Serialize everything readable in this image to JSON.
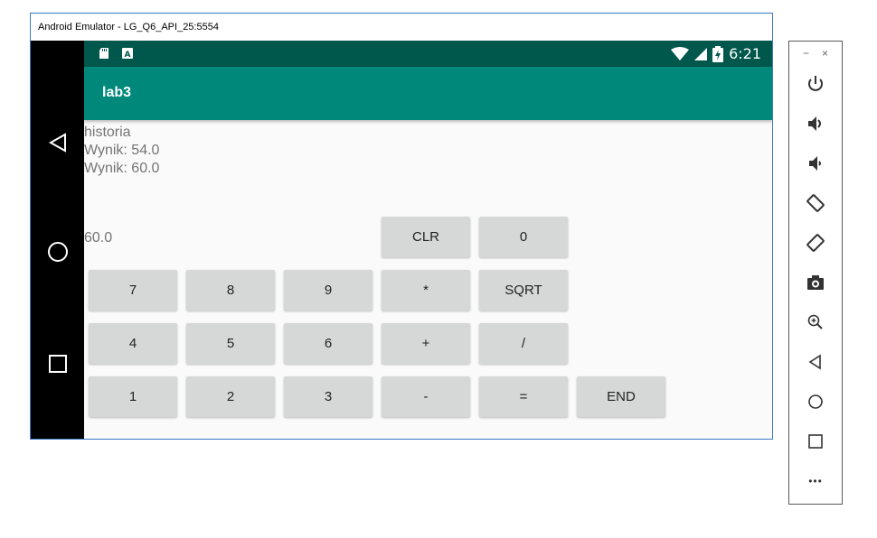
{
  "window": {
    "title": "Android Emulator - LG_Q6_API_25:5554"
  },
  "status_bar": {
    "time": "6:21",
    "icons": [
      "sd-card-icon",
      "keyboard-a-icon",
      "wifi-icon",
      "signal-icon",
      "battery-charging-icon"
    ]
  },
  "app_bar": {
    "title": "lab3"
  },
  "history": {
    "label": "historia",
    "entries": [
      "Wynik: 54.0",
      "Wynik: 60.0"
    ]
  },
  "display": {
    "value": "60.0"
  },
  "keys": {
    "clr": "CLR",
    "zero": "0",
    "seven": "7",
    "eight": "8",
    "nine": "9",
    "mul": "*",
    "sqrt": "SQRT",
    "four": "4",
    "five": "5",
    "six": "6",
    "plus": "+",
    "div": "/",
    "one": "1",
    "two": "2",
    "three": "3",
    "minus": "-",
    "equals": "=",
    "end": "END"
  },
  "side_panel": {
    "minimize": "−",
    "close": "×",
    "buttons": [
      "power-icon",
      "volume-up-icon",
      "volume-down-icon",
      "rotate-left-icon",
      "rotate-right-icon",
      "camera-icon",
      "zoom-icon",
      "back-icon",
      "home-icon",
      "overview-icon",
      "more-icon"
    ],
    "more": "•••"
  },
  "colors": {
    "primary": "#00897b",
    "primary_dark": "#00574b",
    "button": "#d6d7d7",
    "text_gray": "#757575"
  }
}
